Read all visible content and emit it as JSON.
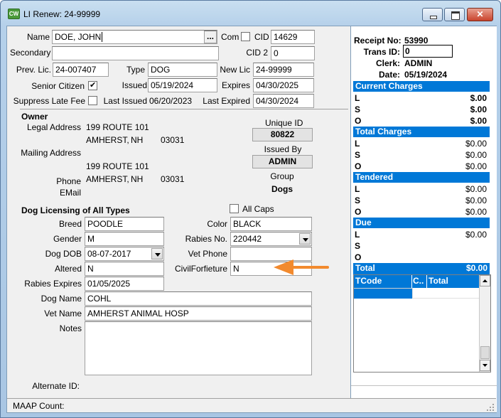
{
  "window": {
    "title": "LI Renew: 24-99999",
    "icon_text": "CW"
  },
  "form": {
    "name_label": "Name",
    "name_value": "DOE, JOHN",
    "lookup_btn": "...",
    "com_label": "Com",
    "cid_label": "CID",
    "cid_value": "14629",
    "secondary_label": "Secondary",
    "cid2_label": "CID 2",
    "cid2_value": "0",
    "prev_lic_label": "Prev. Lic.",
    "prev_lic_value": "24-007407",
    "type_label": "Type",
    "type_value": "DOG",
    "new_lic_label": "New Lic",
    "new_lic_value": "24-99999",
    "senior_label": "Senior Citizen",
    "issued_label": "Issued",
    "issued_value": "05/19/2024",
    "expires_label": "Expires",
    "expires_value": "04/30/2025",
    "suppress_label": "Suppress Late Fee",
    "last_issued_label": "Last Issued",
    "last_issued_value": "06/20/2023",
    "last_expired_label": "Last Expired",
    "last_expired_value": "04/30/2024"
  },
  "owner": {
    "header": "Owner",
    "legal_label": "Legal Address",
    "legal_line1": "199 ROUTE 101",
    "legal_city": "AMHERST,",
    "legal_state": "NH",
    "legal_zip": "03031",
    "mailing_label": "Mailing Address",
    "mail_line1": "199 ROUTE 101",
    "mail_city": "AMHERST,",
    "mail_state": "NH",
    "mail_zip": "03031",
    "phone_label": "Phone",
    "email_label": "EMail",
    "unique_id_label": "Unique ID",
    "unique_id_value": "80822",
    "issued_by_label": "Issued By",
    "issued_by_value": "ADMIN",
    "group_label": "Group",
    "group_value": "Dogs"
  },
  "dog": {
    "header": "Dog Licensing of All Types",
    "all_caps_label": "All Caps",
    "breed_label": "Breed",
    "breed_value": "POODLE",
    "color_label": "Color",
    "color_value": "BLACK",
    "gender_label": "Gender",
    "gender_value": "M",
    "rabies_no_label": "Rabies No.",
    "rabies_no_value": "220442",
    "dob_label": "Dog DOB",
    "dob_value": "08-07-2017",
    "vet_phone_label": "Vet Phone",
    "altered_label": "Altered",
    "altered_value": "N",
    "civil_label": "CivilForfieture",
    "civil_value": "N",
    "rabies_exp_label": "Rabies Expires",
    "rabies_exp_value": "01/05/2025",
    "dog_name_label": "Dog Name",
    "dog_name_value": "COHL",
    "vet_name_label": "Vet Name",
    "vet_name_value": "AMHERST ANIMAL HOSP",
    "notes_label": "Notes",
    "alt_id_label": "Alternate ID:"
  },
  "receipt": {
    "receipt_no_label": "Receipt No:",
    "receipt_no_value": "53990",
    "trans_id_label": "Trans ID:",
    "trans_id_value": "0",
    "clerk_label": "Clerk:",
    "clerk_value": "ADMIN",
    "date_label": "Date:",
    "date_value": "05/19/2024"
  },
  "charges": {
    "current": {
      "title": "Current Charges",
      "rows": [
        {
          "k": "L",
          "v": "$.00"
        },
        {
          "k": "S",
          "v": "$.00"
        },
        {
          "k": "O",
          "v": "$.00"
        }
      ]
    },
    "total": {
      "title": "Total Charges",
      "rows": [
        {
          "k": "L",
          "v": "$0.00"
        },
        {
          "k": "S",
          "v": "$0.00"
        },
        {
          "k": "O",
          "v": "$0.00"
        }
      ]
    },
    "tendered": {
      "title": "Tendered",
      "rows": [
        {
          "k": "L",
          "v": "$0.00"
        },
        {
          "k": "S",
          "v": "$0.00"
        },
        {
          "k": "O",
          "v": "$0.00"
        }
      ]
    },
    "due": {
      "title": "Due",
      "rows": [
        {
          "k": "L",
          "v": "$0.00"
        },
        {
          "k": "S",
          "v": ""
        },
        {
          "k": "O",
          "v": ""
        }
      ]
    },
    "grand_total_label": "Total",
    "grand_total_value": "$0.00"
  },
  "grid": {
    "columns": [
      "TCode",
      "C..",
      "Total"
    ]
  },
  "status": {
    "maap_label": "MAAP Count:"
  },
  "colors": {
    "accent": "#0078d7",
    "arrow": "#f28a2e"
  }
}
